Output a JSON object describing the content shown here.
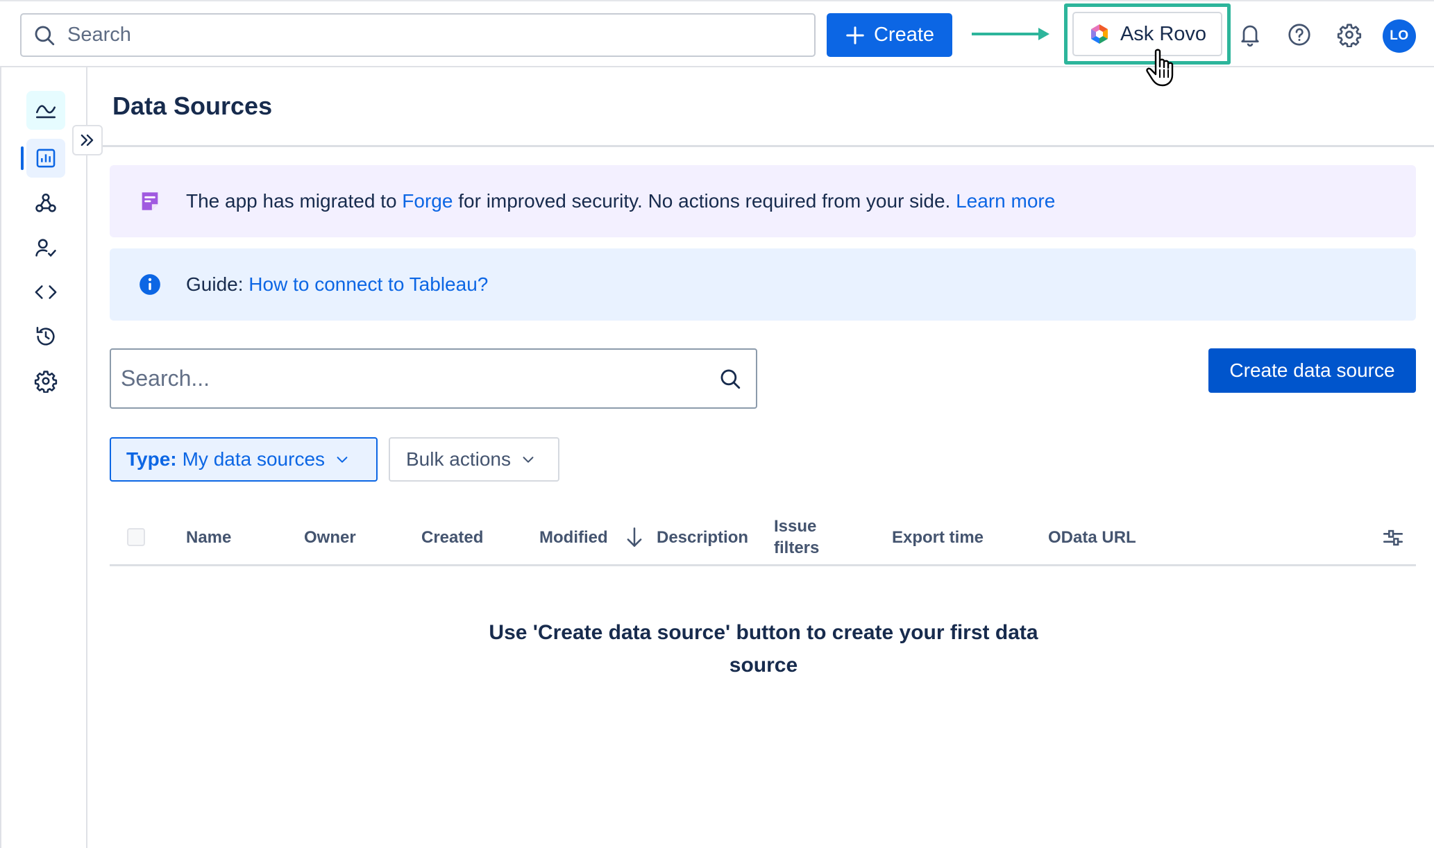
{
  "topnav": {
    "search_placeholder": "Search",
    "create_label": "Create",
    "ask_rovo_label": "Ask Rovo",
    "avatar_initials": "LO",
    "icons": [
      "bell-icon",
      "help-icon",
      "gear-icon"
    ]
  },
  "sidebar": {
    "items": [
      {
        "icon": "app-logo-icon",
        "active": false
      },
      {
        "icon": "bar-chart-icon",
        "active": true
      },
      {
        "icon": "webhook-icon",
        "active": false
      },
      {
        "icon": "user-check-icon",
        "active": false
      },
      {
        "icon": "code-icon",
        "active": false
      },
      {
        "icon": "history-icon",
        "active": false
      },
      {
        "icon": "settings-cog-icon",
        "active": false
      }
    ]
  },
  "page": {
    "title": "Data Sources"
  },
  "banners": {
    "migration": {
      "text_before": "The app has migrated to ",
      "link_forge": "Forge",
      "text_after": " for improved security. No actions required from your side. ",
      "link_learn": "Learn more"
    },
    "guide": {
      "prefix": "Guide: ",
      "link": "How to connect to Tableau?"
    }
  },
  "toolbar": {
    "search_placeholder": "Search...",
    "create_ds_label": "Create data source"
  },
  "filters": {
    "type_label": "Type:",
    "type_value": "My data sources",
    "bulk_label": "Bulk actions"
  },
  "table": {
    "columns": {
      "name": "Name",
      "owner": "Owner",
      "created": "Created",
      "modified": "Modified",
      "description": "Description",
      "issue_filters_1": "Issue",
      "issue_filters_2": "filters",
      "export_time": "Export time",
      "odata_url": "OData URL"
    },
    "sorted_by": "Modified",
    "sort_direction": "descending",
    "empty_line1": "Use 'Create data source' button to create your first data",
    "empty_line2": "source"
  },
  "colors": {
    "primary": "#0c66e4",
    "highlight": "#2db59b",
    "banner_purple": "#f3f0ff",
    "banner_blue": "#e9f2ff"
  }
}
